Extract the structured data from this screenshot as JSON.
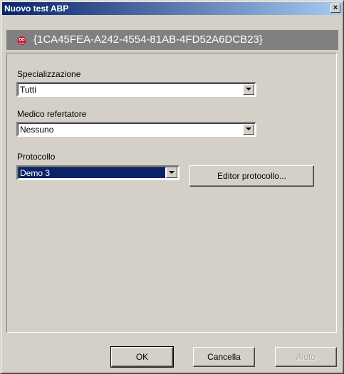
{
  "window": {
    "title": "Nuovo test ABP",
    "close_glyph": "×"
  },
  "header": {
    "icon": "red-mascot-icon",
    "guid": "{1CA45FEA-A242-4554-81AB-4FD52A6DCB23}"
  },
  "form": {
    "specializzazione": {
      "label": "Specializzazione",
      "value": "Tutti"
    },
    "medico": {
      "label": "Medico refertatore",
      "value": "Nessuno"
    },
    "protocollo": {
      "label": "Protocollo",
      "value": "Demo 3"
    },
    "editor_button": "Editor protocollo..."
  },
  "footer": {
    "ok": "OK",
    "cancel": "Cancella",
    "help": "Aiuto"
  },
  "colors": {
    "title_start": "#0a246a",
    "title_end": "#a6caf0",
    "header_band": "#808080",
    "dialog_face": "#d4d0c8",
    "selection": "#0a246a"
  }
}
